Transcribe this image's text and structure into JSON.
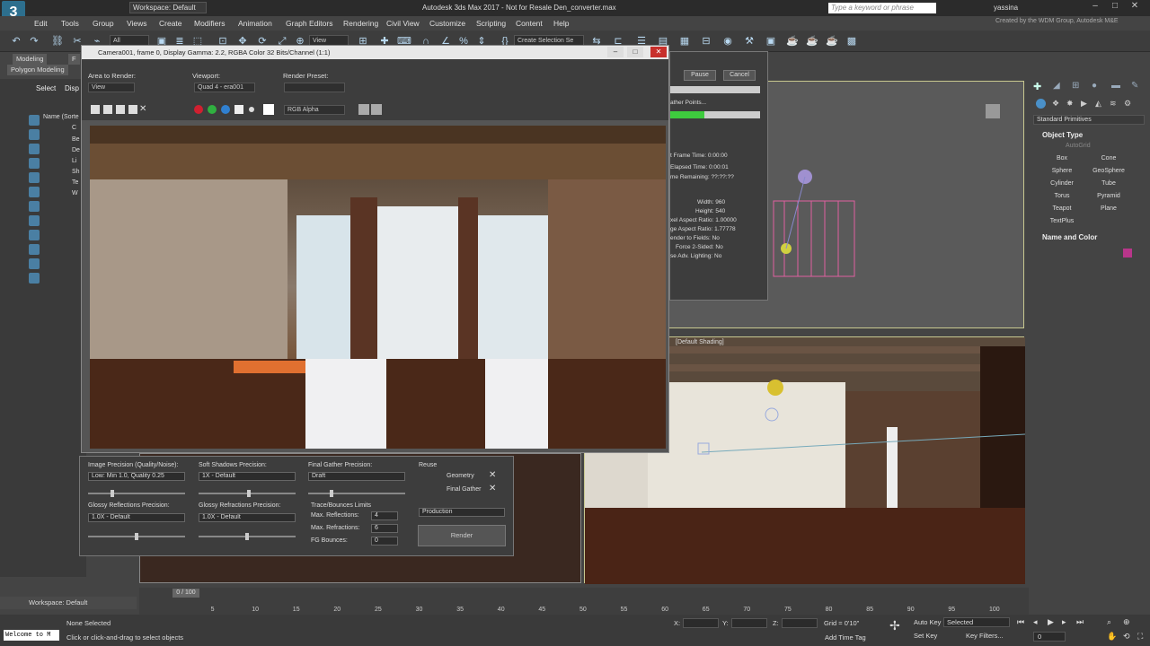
{
  "titlebar": {
    "workspace": "Workspace: Default",
    "window_title": "Autodesk 3ds Max 2017 - Not for Resale   Den_converter.max",
    "search_placeholder": "Type a keyword or phrase",
    "user": "yassina",
    "created_by": "Created by the WDM Group, Autodesk M&E"
  },
  "menu": [
    "Edit",
    "Tools",
    "Group",
    "Views",
    "Create",
    "Modifiers",
    "Animation",
    "Graph Editors",
    "Rendering",
    "Civil View",
    "Customize",
    "Scripting",
    "Content",
    "Help"
  ],
  "toolbar": {
    "filter": "All",
    "view": "View",
    "selection_set": "Create Selection Se"
  },
  "ribbon": {
    "tab_modeling": "Modeling",
    "tab_polygon": "Polygon Modeling",
    "tab_f": "F"
  },
  "explorer": {
    "select": "Select",
    "display": "Disp",
    "name_col": "Name (Sorte",
    "rows": [
      "C",
      "Be",
      "De",
      "Li",
      "Sh",
      "Te",
      "W"
    ]
  },
  "render_window": {
    "title": "Camera001, frame 0, Display Gamma: 2.2, RGBA Color 32 Bits/Channel (1:1)",
    "area_label": "Area to Render:",
    "area_value": "View",
    "viewport_label": "Viewport:",
    "viewport_value": "Quad 4 - era001",
    "preset_label": "Render Preset:",
    "channel": "RGB Alpha"
  },
  "progress_dialog": {
    "pause": "Pause",
    "cancel": "Cancel",
    "gather": "ather Points...",
    "frame_time": "t Frame Time:  0:00:00",
    "elapsed": "Elapsed Time:  0:00:01",
    "remaining": "me Remaining:  ??:??:??",
    "width": "Width: 960",
    "height": "Height: 540",
    "pixel_aspect": "xel Aspect Ratio: 1.00000",
    "image_aspect": "ge Aspect Ratio: 1.77778",
    "fields": "ender to Fields: No",
    "force2": "Force 2-Sided: No",
    "adv": "se Adv. Lighting: No"
  },
  "render_setup": {
    "image_precision_label": "Image Precision (Quality/Noise):",
    "image_precision_value": "Low: Min 1.0, Quality 0.25",
    "soft_shadows_label": "Soft Shadows Precision:",
    "soft_shadows_value": "1X - Default",
    "fg_precision_label": "Final Gather Precision:",
    "fg_precision_value": "Draft",
    "reuse_label": "Reuse",
    "geometry": "Geometry",
    "final_gather": "Final Gather",
    "glossy_refl_label": "Glossy Reflections Precision:",
    "glossy_refl_value": "1.0X - Default",
    "glossy_refr_label": "Glossy Refractions Precision:",
    "glossy_refr_value": "1.0X - Default",
    "trace_label": "Trace/Bounces Limits",
    "max_refl_label": "Max. Reflections:",
    "max_refl": "4",
    "max_refr_label": "Max. Refractions:",
    "max_refr": "6",
    "fg_bounces_label": "FG Bounces:",
    "fg_bounces": "0",
    "mode": "Production",
    "render_button": "Render"
  },
  "command_panel": {
    "category": "Standard Primitives",
    "object_type": "Object Type",
    "autogrid": "AutoGrid",
    "buttons": [
      "Box",
      "Cone",
      "Sphere",
      "GeoSphere",
      "Cylinder",
      "Tube",
      "Torus",
      "Pyramid",
      "Teapot",
      "Plane",
      "TextPlus"
    ],
    "name_color": "Name and Color",
    "swatch_color": "#b8368a"
  },
  "viewport": {
    "label": "[Default Shading]"
  },
  "timeline": {
    "frame": "0 / 100",
    "ticks": [
      "5",
      "10",
      "15",
      "20",
      "25",
      "30",
      "35",
      "40",
      "45",
      "50",
      "55",
      "60",
      "65",
      "70",
      "75",
      "80",
      "85",
      "90",
      "95",
      "100"
    ]
  },
  "status": {
    "workspace": "Workspace: Default",
    "maxscript": "Welcome to M",
    "none_selected": "None Selected",
    "hint": "Click or click-and-drag to select objects",
    "x_label": "X:",
    "y_label": "Y:",
    "z_label": "Z:",
    "grid": "Grid = 0'10\"",
    "add_time_tag": "Add Time Tag",
    "auto_key": "Auto Key",
    "set_key": "Set Key",
    "selected": "Selected",
    "key_filters": "Key Filters...",
    "frame_field": "0"
  }
}
